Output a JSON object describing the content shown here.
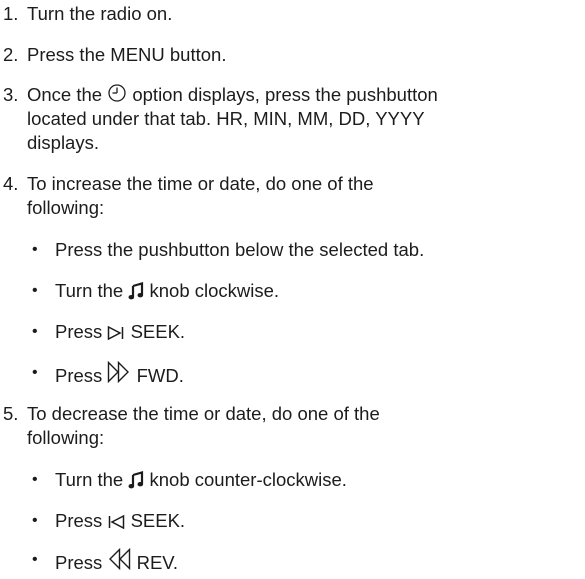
{
  "steps": [
    {
      "num": "1.",
      "text": "Turn the radio on."
    },
    {
      "num": "2.",
      "text": "Press the MENU button."
    },
    {
      "num": "3.",
      "pre": "Once the",
      "icon": "clock-icon",
      "post": "option displays, press the pushbutton",
      "line2": "located under that tab. HR, MIN, MM, DD, YYYY",
      "line3": "displays."
    },
    {
      "num": "4.",
      "line1": "To increase the time or date, do one of the",
      "line2": "following:",
      "bullets": [
        {
          "pre": "Press the pushbutton below the selected tab."
        },
        {
          "pre": "Turn the",
          "icon": "music-note-icon",
          "post": "knob clockwise."
        },
        {
          "pre": "Press",
          "icon": "seek-forward-icon",
          "post": "SEEK."
        },
        {
          "pre": "Press",
          "icon": "fast-forward-icon",
          "post": "FWD."
        }
      ]
    },
    {
      "num": "5.",
      "line1": "To decrease the time or date, do one of the",
      "line2": "following:",
      "bullets": [
        {
          "pre": "Turn the",
          "icon": "music-note-icon",
          "post": "knob counter-clockwise."
        },
        {
          "pre": "Press",
          "icon": "seek-backward-icon",
          "post": "SEEK."
        },
        {
          "pre": "Press",
          "icon": "rewind-icon",
          "post": "REV."
        }
      ]
    }
  ],
  "bullet_char": "•"
}
